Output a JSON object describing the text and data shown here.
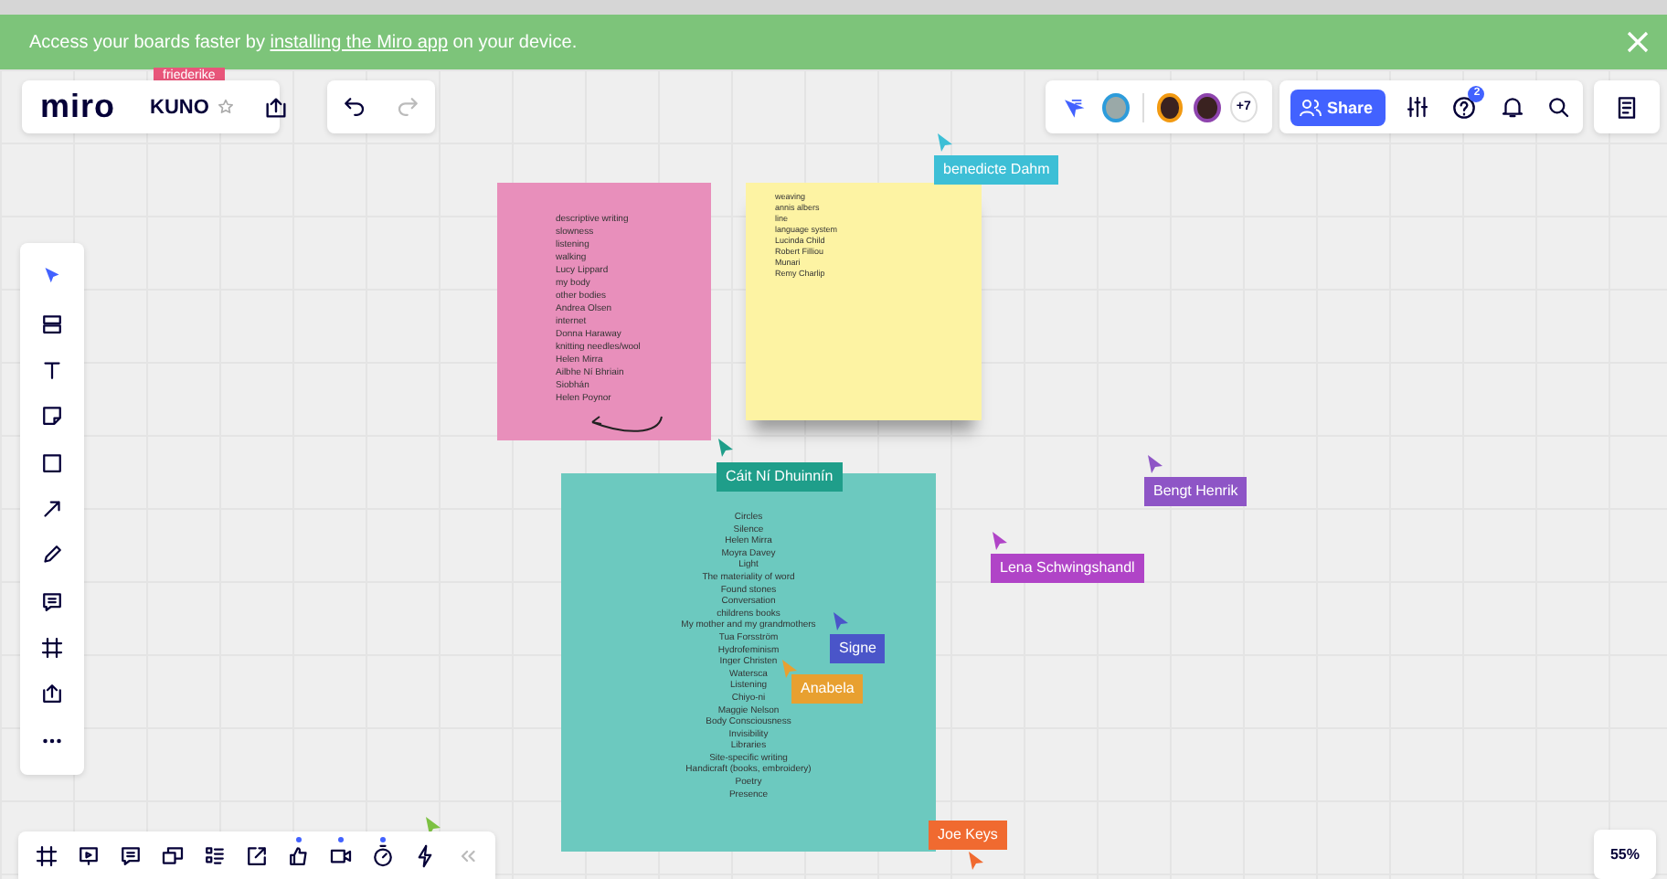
{
  "banner": {
    "text_before": "Access your boards faster by ",
    "link": "installing the Miro app",
    "text_after": " on your device."
  },
  "board": {
    "logo": "miro",
    "name": "KUNO",
    "starred": false
  },
  "history": [
    {
      "kind": "undo",
      "disabled": false
    },
    {
      "kind": "redo",
      "disabled": true
    }
  ],
  "collaborators": {
    "avatars": [
      {
        "color": "#2d9cdb"
      },
      {
        "color": "#f29a12"
      },
      {
        "color": "#8e44ad"
      }
    ],
    "more": "+7"
  },
  "actions": {
    "share": "Share",
    "help_badge": "2"
  },
  "zoom": "55%",
  "tools": [
    {
      "kind": "select",
      "selected": true
    },
    {
      "kind": "templates",
      "selected": false
    },
    {
      "kind": "text",
      "selected": false
    },
    {
      "kind": "sticky",
      "selected": false
    },
    {
      "kind": "shape",
      "selected": false
    },
    {
      "kind": "arrow",
      "selected": false
    },
    {
      "kind": "pen",
      "selected": false
    },
    {
      "kind": "comment",
      "selected": false
    },
    {
      "kind": "frame",
      "selected": false
    },
    {
      "kind": "upload",
      "selected": false
    },
    {
      "kind": "more",
      "selected": false
    }
  ],
  "bottom_tools": [
    {
      "kind": "frame",
      "dot": false
    },
    {
      "kind": "present",
      "dot": false
    },
    {
      "kind": "comment",
      "dot": false
    },
    {
      "kind": "cards",
      "dot": false
    },
    {
      "kind": "kanban",
      "dot": false
    },
    {
      "kind": "export",
      "dot": false
    },
    {
      "kind": "vote",
      "dot": true
    },
    {
      "kind": "video",
      "dot": true
    },
    {
      "kind": "timer",
      "dot": true
    },
    {
      "kind": "lightning",
      "dot": false
    },
    {
      "kind": "collapse",
      "dot": false
    }
  ],
  "notes": [
    {
      "color": "#e88fbb",
      "lines": [
        "descriptive writing",
        "slowness",
        "listening",
        "walking",
        "Lucy Lippard",
        "my body",
        "other bodies",
        "Andrea Olsen",
        "internet",
        "Donna Haraway",
        "knitting needles/wool",
        "Helen Mirra",
        "Ailbhe Ní Bhriain",
        "Siobhán",
        "Helen Poynor"
      ]
    },
    {
      "color": "#fdf3a3",
      "lines": [
        "weaving",
        "annis albers",
        "line",
        "language system",
        "Lucinda Child",
        "Robert Filliou",
        "Munari",
        "Remy Charlip"
      ]
    },
    {
      "color": "#6cc9bf",
      "lines": [
        "Circles",
        "Silence",
        "Helen Mirra",
        "Moyra Davey",
        "Light",
        "The materiality of word",
        "Found stones",
        "Conversation",
        "childrens books",
        "My mother and my grandmothers",
        "Tua Forsström",
        "Hydrofeminism",
        "Inger Christen",
        "Watersca",
        "Listening",
        "Chiyo-ni",
        "Maggie Nelson",
        "Body Consciousness",
        "Invisibility",
        "Libraries",
        "Site-specific writing",
        "Handicraft (books, embroidery)",
        "Poetry",
        "Presence"
      ]
    }
  ],
  "cursors": [
    {
      "name": "friederike",
      "color": "#e8557a"
    },
    {
      "name": "benedicte Dahm",
      "color": "#3dbfd6"
    },
    {
      "name": "Cáit Ní Dhuinnín",
      "color": "#1f9e8a"
    },
    {
      "name": "Bengt Henrik",
      "color": "#8e55c6"
    },
    {
      "name": "Lena Schwingshandl",
      "color": "#b044c7"
    },
    {
      "name": "Signe",
      "color": "#4a55c9"
    },
    {
      "name": "Anabela",
      "color": "#e8a030"
    },
    {
      "name": "Joe Keys",
      "color": "#f06a30"
    },
    {
      "color": "#7cc142"
    }
  ]
}
